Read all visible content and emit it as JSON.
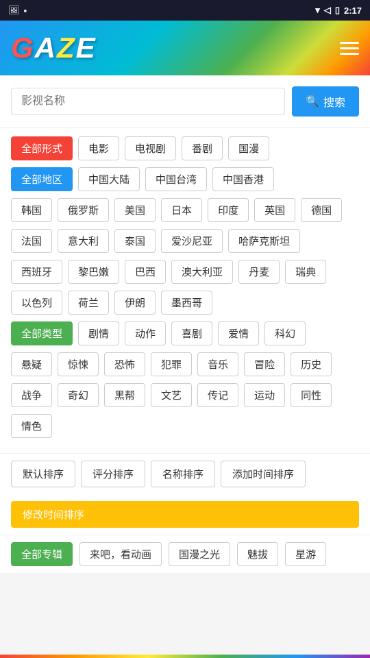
{
  "statusBar": {
    "time": "2:17",
    "icons": [
      "photo",
      "square",
      "wifi",
      "signal",
      "battery"
    ]
  },
  "header": {
    "logo": "GAZE",
    "menuLabel": "菜单"
  },
  "search": {
    "placeholder": "影视名称",
    "buttonLabel": "搜索"
  },
  "filters": {
    "formatLabel": "全部形式",
    "formats": [
      "电影",
      "电视剧",
      "番剧",
      "国漫"
    ],
    "regionLabel": "全部地区",
    "regions1": [
      "中国大陆",
      "中国台湾",
      "中国香港"
    ],
    "regions2": [
      "韩国",
      "俄罗斯",
      "美国",
      "日本",
      "印度",
      "英国",
      "德国"
    ],
    "regions3": [
      "法国",
      "意大利",
      "泰国",
      "爱沙尼亚",
      "哈萨克斯坦"
    ],
    "regions4": [
      "西班牙",
      "黎巴嫩",
      "巴西",
      "澳大利亚",
      "丹麦",
      "瑞典"
    ],
    "regions5": [
      "以色列",
      "荷兰",
      "伊朗",
      "墨西哥"
    ],
    "genreLabel": "全部类型",
    "genres1": [
      "剧情",
      "动作",
      "喜剧",
      "爱情",
      "科幻"
    ],
    "genres2": [
      "悬疑",
      "惊悚",
      "恐怖",
      "犯罪",
      "音乐",
      "冒险",
      "历史"
    ],
    "genres3": [
      "战争",
      "奇幻",
      "黑帮",
      "文艺",
      "传记",
      "运动",
      "同性"
    ],
    "genres4": [
      "情色"
    ]
  },
  "sort": {
    "options": [
      "默认排序",
      "评分排序",
      "名称排序",
      "添加时间排序"
    ],
    "activeOption": "修改时间排序"
  },
  "special": {
    "label": "全部专辑",
    "items": [
      "来吧，看动画",
      "国漫之光",
      "魅拔",
      "星游"
    ]
  }
}
